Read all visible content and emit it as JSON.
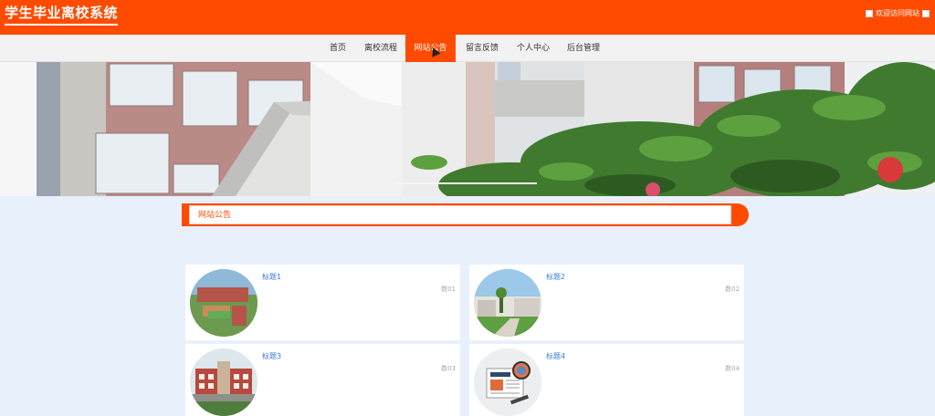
{
  "header": {
    "site_title": "学生毕业离校系统",
    "welcome": "欢迎访问网站"
  },
  "nav": {
    "items": [
      {
        "label": "首页"
      },
      {
        "label": "离校流程"
      },
      {
        "label": "网站公告"
      },
      {
        "label": "留言反馈"
      },
      {
        "label": "个人中心"
      },
      {
        "label": "后台管理"
      }
    ],
    "active_index": 2
  },
  "banner": {
    "image": "campus-building-with-flowering-plants"
  },
  "section": {
    "title": "网站公告"
  },
  "cards": [
    {
      "title": "标题1",
      "date": "数01",
      "image": "campus-aerial-icon"
    },
    {
      "title": "标题2",
      "date": "数02",
      "image": "campus-lawn-icon"
    },
    {
      "title": "标题3",
      "date": "数03",
      "image": "school-building-icon"
    },
    {
      "title": "标题4",
      "date": "数04",
      "image": "news-paper-icon"
    }
  ],
  "colors": {
    "brand": "#ff4b00",
    "page_bg": "#e8f0fb",
    "link": "#3b7cd4"
  }
}
